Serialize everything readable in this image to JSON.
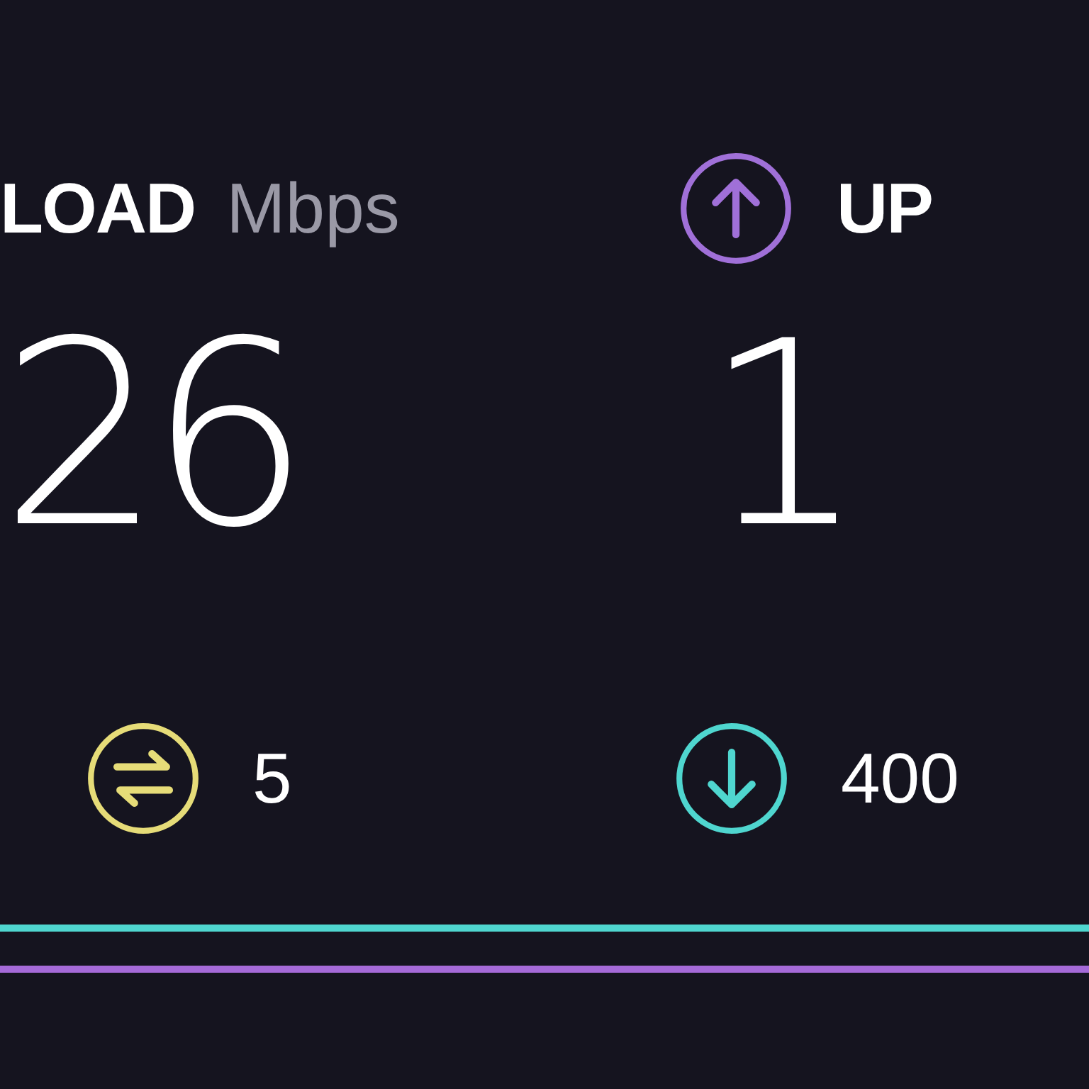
{
  "download": {
    "label": "LOAD",
    "unit": "Mbps",
    "value": "26"
  },
  "upload": {
    "label": "UP",
    "value": "1"
  },
  "stats": [
    {
      "kind": "ping",
      "value": "5",
      "color": "#e6dc78"
    },
    {
      "kind": "download",
      "value": "400",
      "color": "#4fd6cf"
    }
  ]
}
